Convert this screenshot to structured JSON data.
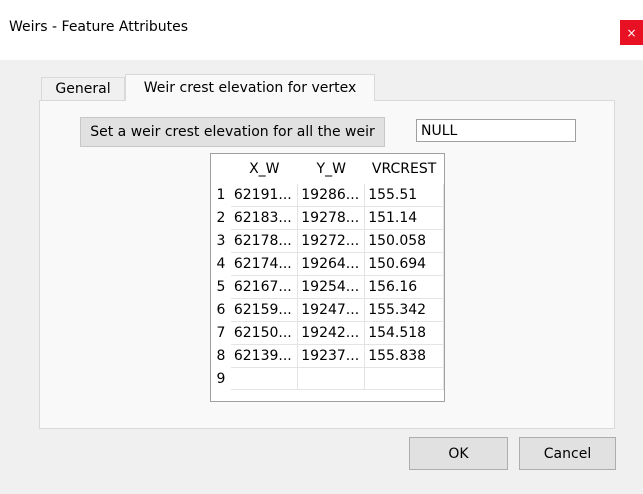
{
  "window": {
    "title": "Weirs - Feature Attributes",
    "close_glyph": "×"
  },
  "tabs": [
    {
      "label": "General",
      "active": false
    },
    {
      "label": "Weir crest elevation for vertex",
      "active": true
    }
  ],
  "weir_tab": {
    "set_button_label": "Set a weir crest elevation for all the weir",
    "elevation_value": "NULL",
    "table": {
      "columns": [
        "X_W",
        "Y_W",
        "VRCREST"
      ],
      "rows": [
        {
          "num": "1",
          "x": "62191...",
          "y": "19286...",
          "z": "155.51"
        },
        {
          "num": "2",
          "x": "62183...",
          "y": "19278...",
          "z": "151.14"
        },
        {
          "num": "3",
          "x": "62178...",
          "y": "19272...",
          "z": "150.058"
        },
        {
          "num": "4",
          "x": "62174...",
          "y": "19264...",
          "z": "150.694"
        },
        {
          "num": "5",
          "x": "62167...",
          "y": "19254...",
          "z": "156.16"
        },
        {
          "num": "6",
          "x": "62159...",
          "y": "19247...",
          "z": "155.342"
        },
        {
          "num": "7",
          "x": "62150...",
          "y": "19242...",
          "z": "154.518"
        },
        {
          "num": "8",
          "x": "62139...",
          "y": "19237...",
          "z": "155.838"
        },
        {
          "num": "9",
          "x": "",
          "y": "",
          "z": ""
        }
      ]
    }
  },
  "buttons": {
    "ok_label": "OK",
    "cancel_label": "Cancel"
  },
  "colors": {
    "close_red": "#e81123",
    "window_bg": "#f0f0f0",
    "panel_bg": "#f9f9f9"
  }
}
